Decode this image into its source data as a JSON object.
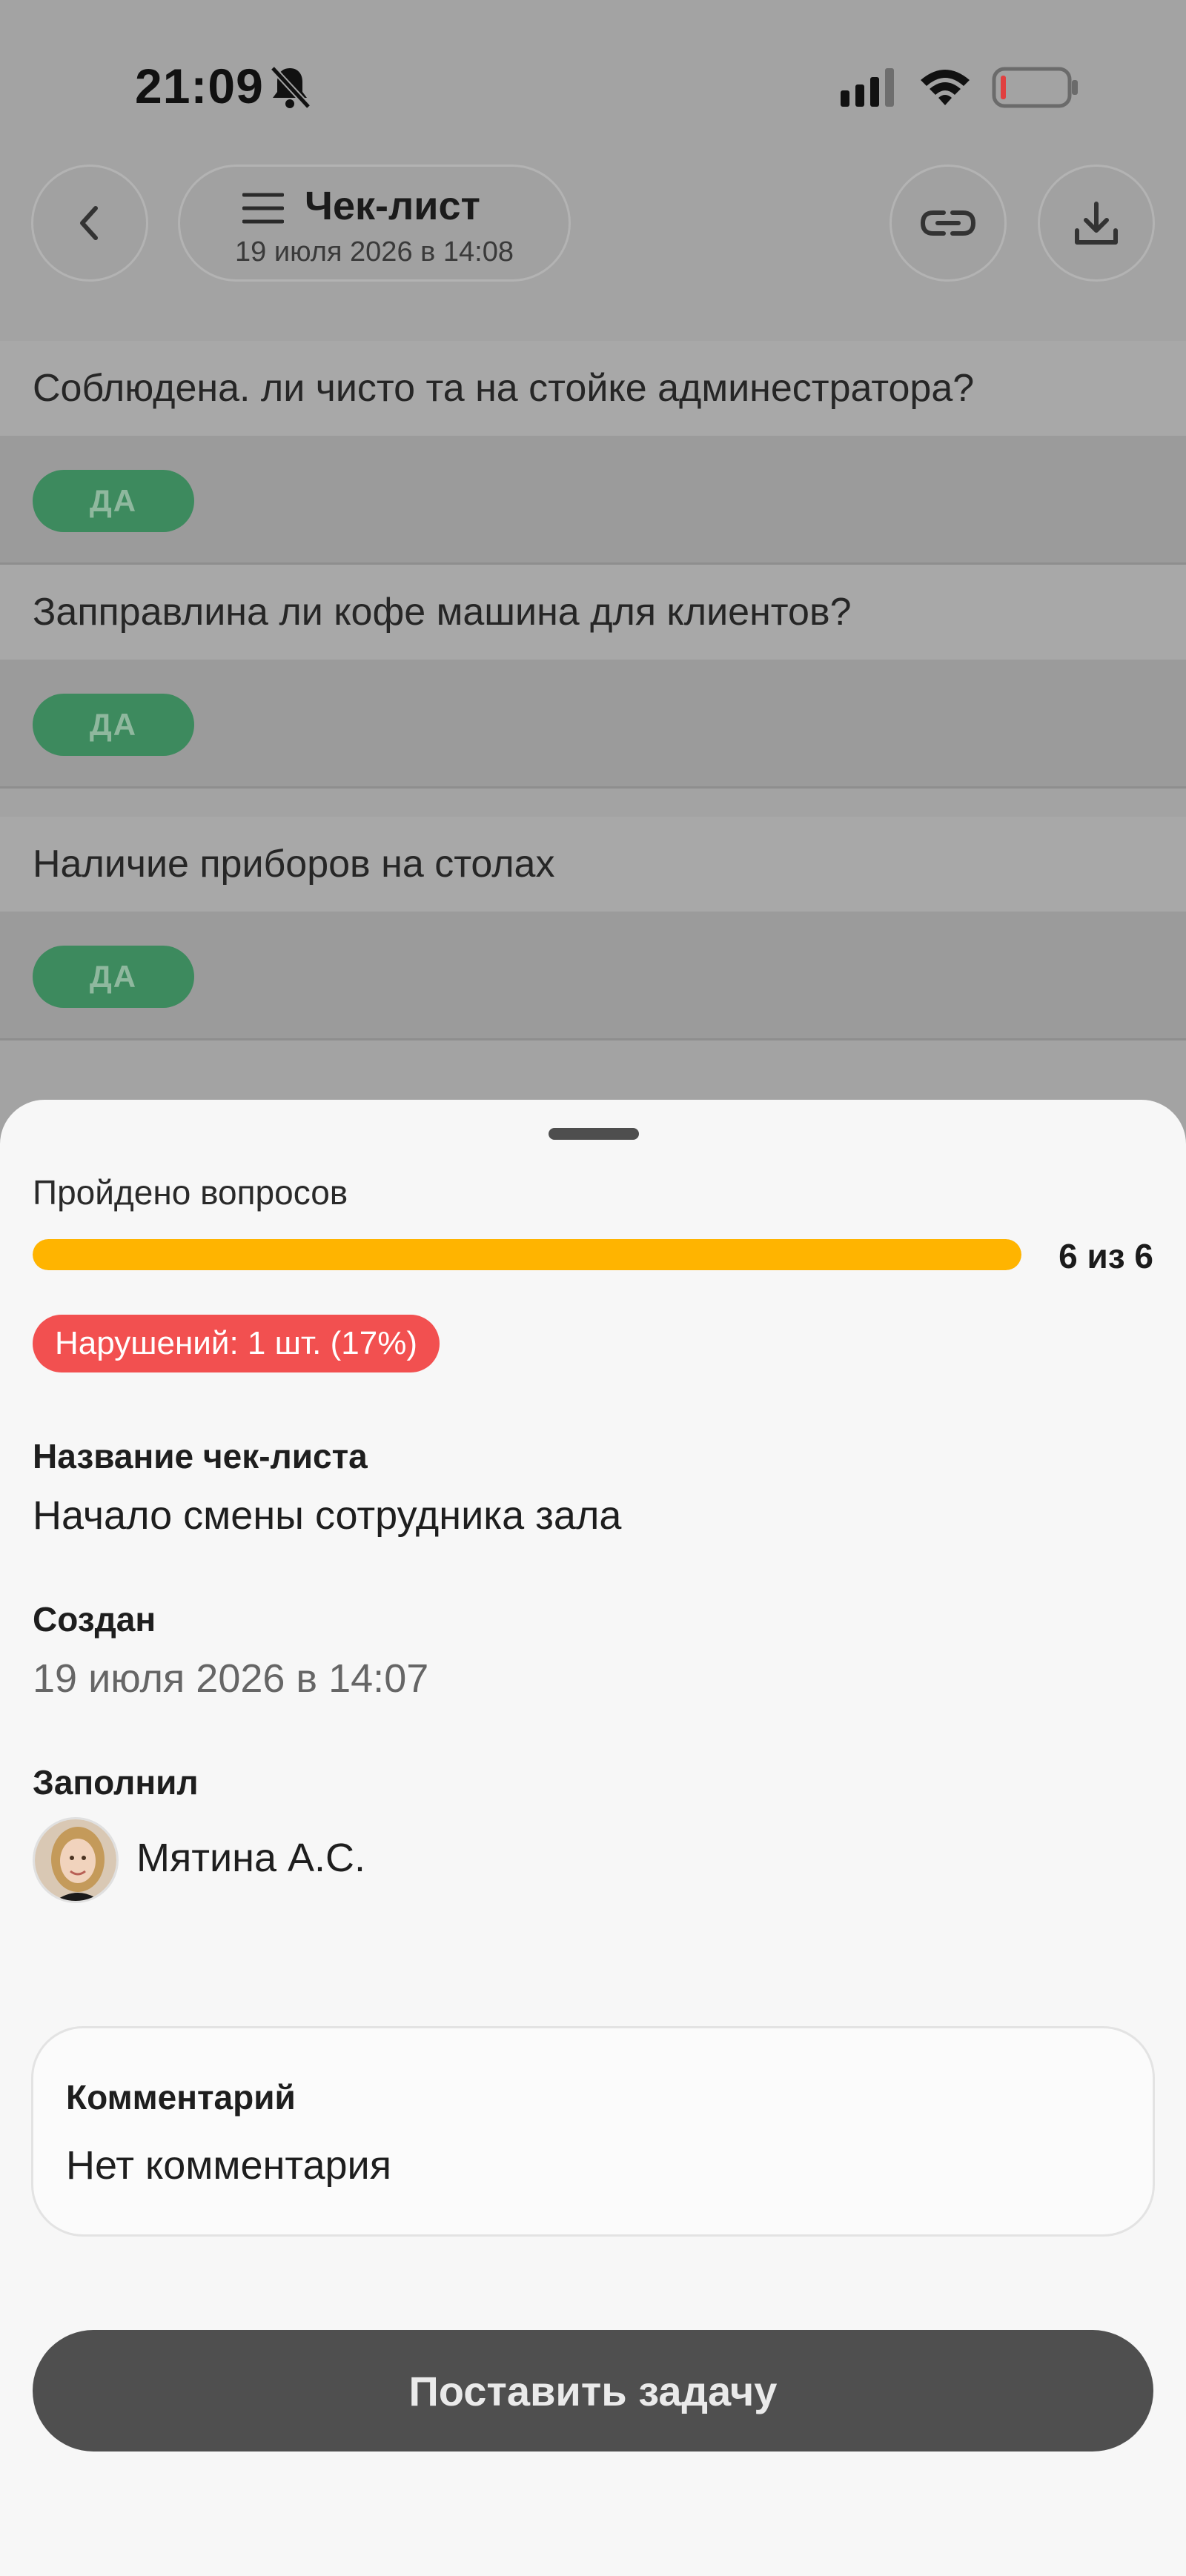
{
  "status_bar": {
    "time": "21:09",
    "icons": [
      "bell-off-icon",
      "signal-icon",
      "wifi-icon",
      "battery-low-icon"
    ]
  },
  "header": {
    "title": "Чек-лист",
    "subtitle": "19 июля 2026 в 14:08",
    "icons": [
      "back-arrow-icon",
      "menu-icon",
      "link-icon",
      "download-icon"
    ]
  },
  "checklist": {
    "items": [
      {
        "question": "Соблюдена. ли чисто та на стойке админестратора?",
        "answer": "ДА"
      },
      {
        "question": "Запправлина ли кофе машина для клиентов?",
        "answer": "ДА"
      },
      {
        "question": "Наличие приборов на столах",
        "answer": "ДА"
      }
    ]
  },
  "summary": {
    "progress_label": "Пройдено вопросов",
    "progress_count": "6 из 6",
    "progress_fraction": 1.0,
    "violations": "Нарушений: 1 шт. (17%)",
    "name_label": "Название чек-листа",
    "name_value": "Начало смены сотрудника зала",
    "created_label": "Создан",
    "created_value": "19 июля 2026 в 14:07",
    "filled_label": "Заполнил",
    "filled_by": "Мятина А.С.",
    "comment_label": "Комментарий",
    "comment_value": "Нет комментария",
    "task_button": "Поставить задачу"
  },
  "colors": {
    "progress": "#ffb400",
    "violation": "#f25050",
    "answer_yes": "#3d8a5e",
    "button": "#4f4f4f"
  }
}
